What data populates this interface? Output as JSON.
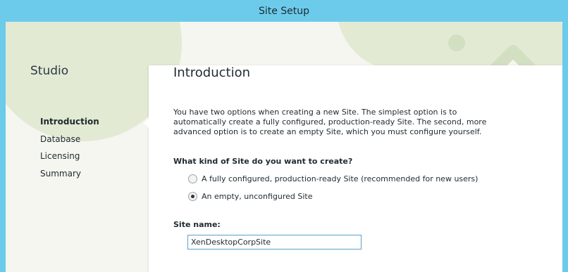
{
  "window": {
    "title": "Site Setup"
  },
  "sidebar": {
    "title": "Studio",
    "items": [
      {
        "label": "Introduction",
        "active": true
      },
      {
        "label": "Database",
        "active": false
      },
      {
        "label": "Licensing",
        "active": false
      },
      {
        "label": "Summary",
        "active": false
      }
    ]
  },
  "main": {
    "title": "Introduction",
    "description": "You have two options when creating a new Site. The simplest option is to automatically create a fully configured, production-ready Site. The second, more advanced option is to create an empty Site, which you must configure yourself.",
    "question": "What kind of Site do you want to create?",
    "options": [
      {
        "label": "A fully configured, production-ready Site (recommended for new users)",
        "selected": false
      },
      {
        "label": "An empty, unconfigured Site",
        "selected": true
      }
    ],
    "site_name_label": "Site name:",
    "site_name_value": "XenDesktopCorpSite"
  },
  "colors": {
    "titlebar": "#6ccbea",
    "background": "#f4f6ef",
    "decoration": "#dfe8cf"
  }
}
